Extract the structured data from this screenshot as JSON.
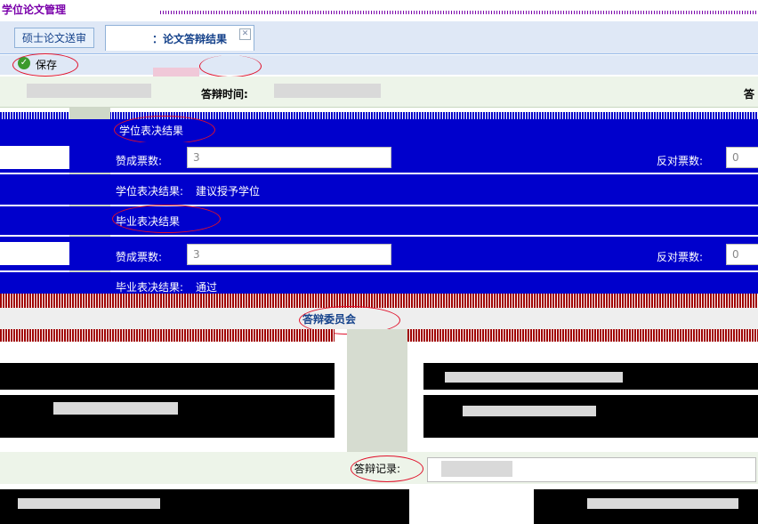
{
  "app": {
    "title": "学位论文管理"
  },
  "tabs": [
    {
      "label": "硕士论文送审"
    },
    {
      "label": "：论文答辩结果"
    }
  ],
  "toolbar": {
    "save_label": "保存"
  },
  "defense": {
    "time_label": "答辩时间:",
    "record_label": "答辩记录:"
  },
  "degree": {
    "section_title": "学位表决结果",
    "votes_label": "赞成票数:",
    "votes_value": "3",
    "against_label": "反对票数:",
    "against_value": "0",
    "result_label": "学位表决结果:",
    "result_value": "建议授予学位"
  },
  "graduation": {
    "section_title": "毕业表决结果",
    "votes_label": "赞成票数:",
    "votes_value": "3",
    "against_label": "反对票数:",
    "against_value": "0",
    "result_label": "毕业表决结果:",
    "result_value": "通过"
  },
  "committee": {
    "section_title": "答辩委员会"
  },
  "colors": {
    "accent_blue": "#0000cc",
    "highlight_red": "#e0102a"
  }
}
